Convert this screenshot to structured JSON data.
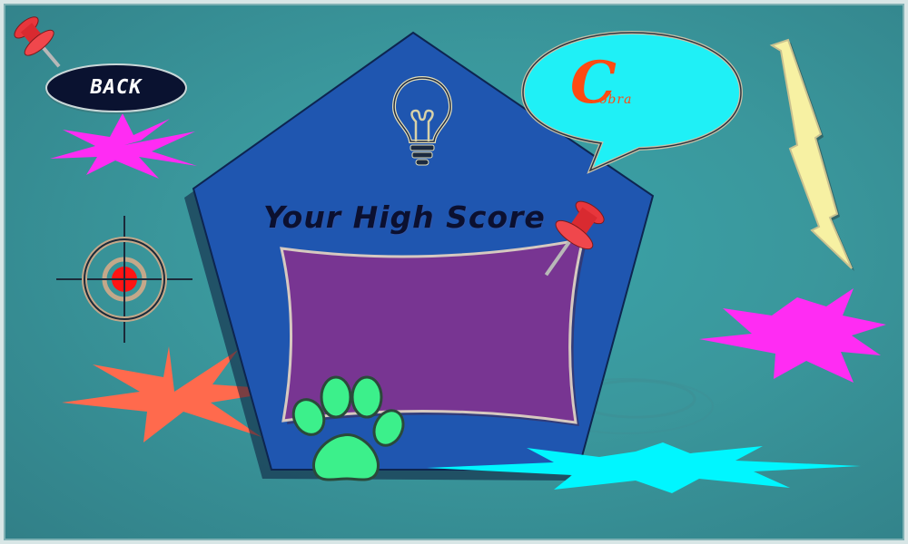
{
  "screen": "high-score",
  "back_button": {
    "label": "BACK"
  },
  "panel": {
    "title": "Your High Score"
  },
  "logo": {
    "letter": "C",
    "text": "obra"
  },
  "colors": {
    "background": "#3a9ca1",
    "pentagon": "#1f56b0",
    "score_board": "#783592",
    "burst_magenta": "#ff2cf3",
    "burst_orange": "#ff6a4d",
    "burst_cyan": "#00f6ff",
    "paw": "#3cf08b",
    "speech_bubble": "#1ff0f6",
    "lightning": "#f7f1a3",
    "pin": "#e8363c"
  },
  "icons": [
    "push-pin-icon",
    "crosshair-icon",
    "lightbulb-icon",
    "paw-icon",
    "lightning-icon",
    "speech-bubble-icon"
  ]
}
